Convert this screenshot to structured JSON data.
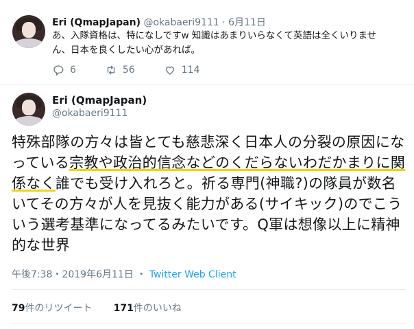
{
  "reply": {
    "name": "Eri (QmapJapan)",
    "handle": "@okabaeri9111",
    "separator": "·",
    "date": "6月11日",
    "text": "あ、入隊資格は、特になしですw 知識はあまりいらなくて英語は全くいりません、日本を良くしたい心があれば。",
    "actions": {
      "reply_count": "6",
      "retweet_count": "56",
      "like_count": "114"
    }
  },
  "main": {
    "name": "Eri (QmapJapan)",
    "handle": "@okabaeri9111",
    "text_parts": [
      "特殊部隊の方々は皆とても慈悲深く日本人の分裂の原因になっている",
      "宗教や政治的信念などのくだらないわだかまりに関係なく",
      "誰でも受け入れろと。祈る専門(神職?)の隊員が数名いてその方々が人を見抜く能力がある(サイキック)のでこういう選考基準になってるみたいです。Q軍は想像以上に精神的な世界"
    ],
    "timestamp": "午後7:38・2019年6月11日",
    "client": "Twitter Web Client",
    "retweets_num": "79",
    "retweets_label": "件のリツイート",
    "likes_num": "171",
    "likes_label": "件のいいね"
  },
  "colors": {
    "accent": "#1da1f2",
    "highlight": "#f2d211",
    "muted": "#657786"
  }
}
